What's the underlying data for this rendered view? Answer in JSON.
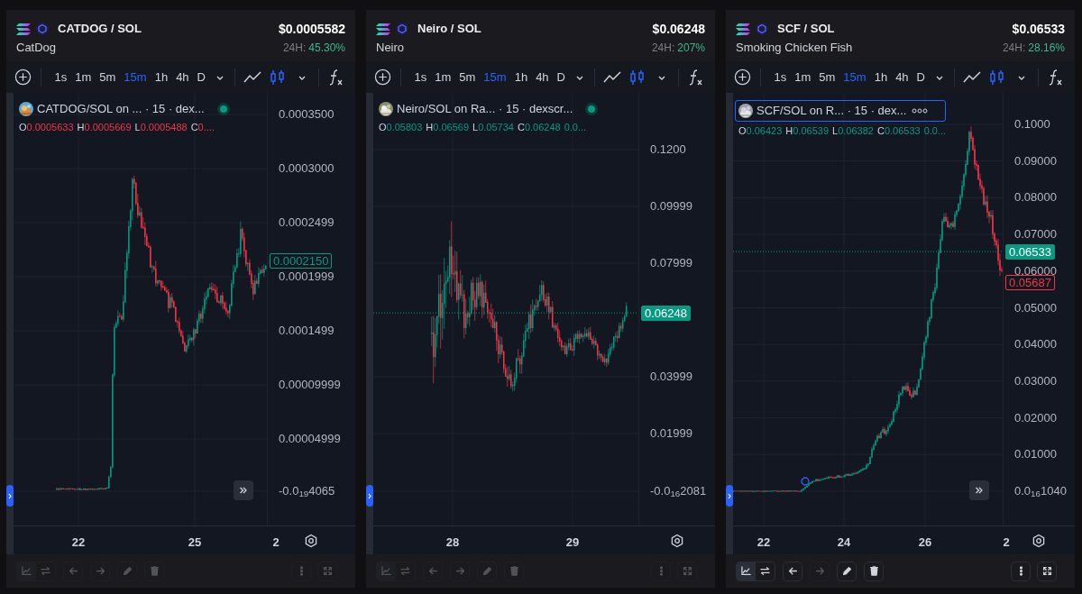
{
  "panels": [
    {
      "pair": "CATDOG / SOL",
      "name": "CatDog",
      "price": "$0.0005582",
      "change_label": "24H:",
      "change": "45.30%",
      "intervals": [
        {
          "label": "1s",
          "selected": false
        },
        {
          "label": "1m",
          "selected": false
        },
        {
          "label": "5m",
          "selected": false
        },
        {
          "label": "15m",
          "selected": true
        },
        {
          "label": "1h",
          "selected": false
        },
        {
          "label": "4h",
          "selected": false
        },
        {
          "label": "D",
          "selected": false
        }
      ],
      "chart_types": [
        {
          "kind": "line",
          "selected": false
        },
        {
          "kind": "candles",
          "selected": true
        }
      ],
      "legend": {
        "title": "CATDOG/SOL on ... · 15 · dex...",
        "selected": false,
        "color": "#f23645",
        "ohlc": [
          {
            "key": "O",
            "value": "0.0005633"
          },
          {
            "key": "H",
            "value": "0.0005669"
          },
          {
            "key": "L",
            "value": "0.0005488"
          },
          {
            "key": "C",
            "value": "0...."
          }
        ]
      },
      "y_ticks": [
        {
          "label": "0.0003500",
          "kind": "plain"
        },
        {
          "label": "0.0003000",
          "kind": "plain"
        },
        {
          "label": "0.0002499",
          "kind": "plain"
        },
        {
          "label": "0.0001999",
          "kind": "plain"
        },
        {
          "label": "0.0001499",
          "kind": "plain"
        },
        {
          "label": "0.00009999",
          "kind": "plain"
        },
        {
          "label": "0.00004999",
          "kind": "plain"
        },
        {
          "label": "-0.0$_{19}$4065",
          "kind": "compact"
        }
      ],
      "price_tags": [
        {
          "text": "0.0002150",
          "kind": "outlined",
          "color": "#089981"
        }
      ],
      "x_ticks": [
        "22",
        "25",
        "2"
      ],
      "scroll_button": true,
      "bottom_tools": [
        {
          "kind": "chart",
          "disabled": true
        },
        {
          "kind": "swap",
          "disabled": true
        },
        {
          "kind": "back",
          "disabled": true
        },
        {
          "kind": "forward",
          "disabled": true
        },
        {
          "kind": "pencil",
          "disabled": true
        },
        {
          "kind": "trash",
          "disabled": true
        },
        {
          "kind": "more",
          "disabled": true
        },
        {
          "kind": "fullscreen",
          "disabled": true
        }
      ]
    },
    {
      "pair": "Neiro / SOL",
      "name": "Neiro",
      "price": "$0.06248",
      "change_label": "24H:",
      "change": "207%",
      "intervals": [
        {
          "label": "1s",
          "selected": false
        },
        {
          "label": "1m",
          "selected": false
        },
        {
          "label": "5m",
          "selected": false
        },
        {
          "label": "15m",
          "selected": true
        },
        {
          "label": "1h",
          "selected": false
        },
        {
          "label": "4h",
          "selected": false
        },
        {
          "label": "D",
          "selected": false
        }
      ],
      "chart_types": [
        {
          "kind": "line",
          "selected": false
        },
        {
          "kind": "candles",
          "selected": true
        }
      ],
      "legend": {
        "title": "Neiro/SOL on Ra... · 15 · dexscr...",
        "selected": false,
        "color": "#089981",
        "ohlc": [
          {
            "key": "O",
            "value": "0.05803"
          },
          {
            "key": "H",
            "value": "0.06569"
          },
          {
            "key": "L",
            "value": "0.05734"
          },
          {
            "key": "C",
            "value": "0.06248"
          }
        ],
        "extra": "0.0..."
      },
      "y_ticks": [
        {
          "label": "0.1200",
          "kind": "plain"
        },
        {
          "label": "0.09999",
          "kind": "plain"
        },
        {
          "label": "0.07999",
          "kind": "plain"
        },
        {
          "label": "0.03999",
          "kind": "plain"
        },
        {
          "label": "0.01999",
          "kind": "plain"
        },
        {
          "label": "-0.0$_{16}$2081",
          "kind": "compact"
        }
      ],
      "price_tags": [
        {
          "text": "0.06248",
          "kind": "filled",
          "color": "#089981"
        }
      ],
      "x_ticks": [
        "28",
        "29"
      ],
      "bottom_tools": [
        {
          "kind": "chart",
          "disabled": true
        },
        {
          "kind": "swap",
          "disabled": true
        },
        {
          "kind": "back",
          "disabled": true
        },
        {
          "kind": "forward",
          "disabled": true
        },
        {
          "kind": "pencil",
          "disabled": true
        },
        {
          "kind": "trash",
          "disabled": true
        },
        {
          "kind": "more",
          "disabled": true
        },
        {
          "kind": "fullscreen",
          "disabled": true
        }
      ]
    },
    {
      "pair": "SCF / SOL",
      "name": "Smoking Chicken Fish",
      "price": "$0.06533",
      "change_label": "24H:",
      "change": "28.16%",
      "intervals": [
        {
          "label": "1s",
          "selected": false
        },
        {
          "label": "1m",
          "selected": false
        },
        {
          "label": "5m",
          "selected": false
        },
        {
          "label": "15m",
          "selected": true
        },
        {
          "label": "1h",
          "selected": false
        },
        {
          "label": "4h",
          "selected": false
        },
        {
          "label": "D",
          "selected": false
        }
      ],
      "chart_types": [
        {
          "kind": "line",
          "selected": false
        },
        {
          "kind": "candles",
          "selected": true
        }
      ],
      "legend": {
        "title": "SCF/SOL on R... · 15 · dex...",
        "selected": true,
        "color": "#089981",
        "ohlc": [
          {
            "key": "O",
            "value": "0.06423"
          },
          {
            "key": "H",
            "value": "0.06539"
          },
          {
            "key": "L",
            "value": "0.06382"
          },
          {
            "key": "C",
            "value": "0.06533"
          }
        ],
        "extra": "0.0..."
      },
      "y_ticks": [
        {
          "label": "0.1000",
          "kind": "plain"
        },
        {
          "label": "0.09000",
          "kind": "plain"
        },
        {
          "label": "0.08000",
          "kind": "plain"
        },
        {
          "label": "0.07000",
          "kind": "plain"
        },
        {
          "label": "0.06000",
          "kind": "plain"
        },
        {
          "label": "0.05000",
          "kind": "plain"
        },
        {
          "label": "0.04000",
          "kind": "plain"
        },
        {
          "label": "0.03000",
          "kind": "plain"
        },
        {
          "label": "0.02000",
          "kind": "plain"
        },
        {
          "label": "0.01000",
          "kind": "plain"
        },
        {
          "label": "0.0$_{16}$1040",
          "kind": "compact"
        }
      ],
      "price_tags": [
        {
          "text": "0.06533",
          "kind": "filled",
          "color": "#089981"
        },
        {
          "text": "0.05687",
          "kind": "outlined",
          "color": "#f23645"
        }
      ],
      "x_ticks": [
        "22",
        "24",
        "26",
        "2"
      ],
      "scroll_button": true,
      "marker": true,
      "bottom_tools": [
        {
          "kind": "chart",
          "disabled": false
        },
        {
          "kind": "swap",
          "disabled": false
        },
        {
          "kind": "back",
          "disabled": false
        },
        {
          "kind": "forward",
          "disabled": true
        },
        {
          "kind": "pencil",
          "disabled": false
        },
        {
          "kind": "trash",
          "disabled": false
        },
        {
          "kind": "more",
          "disabled": false
        },
        {
          "kind": "fullscreen",
          "disabled": false
        }
      ]
    }
  ]
}
